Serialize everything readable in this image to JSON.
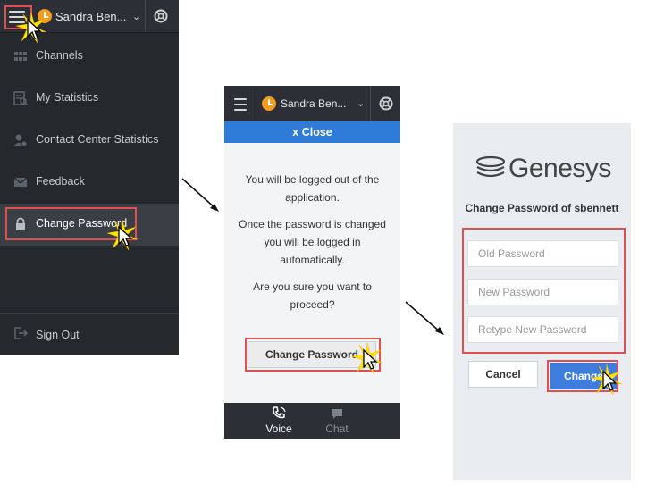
{
  "panel_menu": {
    "agent_name": "Sandra Ben...",
    "items": [
      {
        "label": "Channels",
        "icon": "grid-icon"
      },
      {
        "label": "My Statistics",
        "icon": "statistics-icon"
      },
      {
        "label": "Contact Center Statistics",
        "icon": "contact-center-icon"
      },
      {
        "label": "Feedback",
        "icon": "envelope-icon"
      },
      {
        "label": "Change Password",
        "icon": "lock-icon"
      }
    ],
    "sign_out": "Sign Out"
  },
  "panel_confirm": {
    "agent_name": "Sandra Ben...",
    "close_label": "x Close",
    "message_1": "You will be logged out of the application.",
    "message_2": "Once the password is changed you will be logged in automatically.",
    "message_3": "Are you sure you want to proceed?",
    "button_label": "Change Password",
    "tabs": [
      {
        "label": "Voice",
        "icon": "phone-icon"
      },
      {
        "label": "Chat",
        "icon": "chat-icon"
      }
    ]
  },
  "panel_change": {
    "logo_text": "Genesys",
    "title": "Change Password of sbennett",
    "old_password_placeholder": "Old Password",
    "new_password_placeholder": "New Password",
    "retype_placeholder": "Retype New Password",
    "cancel_label": "Cancel",
    "change_label": "Change"
  },
  "colors": {
    "highlight_red": "#e05050",
    "accent_blue": "#2e7bd8",
    "status_orange": "#f39c1f",
    "dark_bg": "#25282d"
  }
}
